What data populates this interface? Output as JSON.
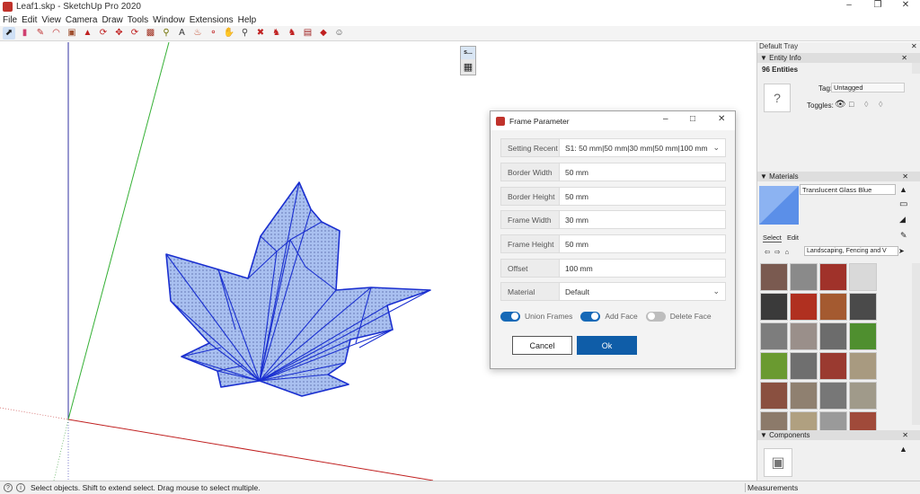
{
  "window": {
    "title": "Leaf1.skp - SketchUp Pro 2020",
    "minimize": "–",
    "maximize": "❐",
    "close": "✕"
  },
  "menu": [
    "File",
    "Edit",
    "View",
    "Camera",
    "Draw",
    "Tools",
    "Window",
    "Extensions",
    "Help"
  ],
  "toolbar_icons": [
    "select-arrow-icon",
    "eraser-icon",
    "pencil-line-icon",
    "arc-icon",
    "rectangle-icon",
    "push-pull-icon",
    "follow-me-icon",
    "move-icon",
    "rotate-icon",
    "scale-icon",
    "tape-measure-icon",
    "text-icon",
    "paint-bucket-icon",
    "orbit-icon",
    "pan-icon",
    "zoom-icon",
    "zoom-extents-icon",
    "warehouse-icon",
    "extension-warehouse-icon",
    "layout-icon",
    "ruby-icon",
    "profile-icon"
  ],
  "mini_toolbar": {
    "label": "s...",
    "icon": "frame-grid-icon"
  },
  "dialog": {
    "title": "Frame Parameter",
    "fields": [
      {
        "label": "Setting Recent",
        "value": "S1: 50 mm|50 mm|30 mm|50 mm|100 mm",
        "dropdown": true
      },
      {
        "label": "Border Width",
        "value": "50 mm",
        "dropdown": false
      },
      {
        "label": "Border Height",
        "value": "50 mm",
        "dropdown": false
      },
      {
        "label": "Frame Width",
        "value": "30 mm",
        "dropdown": false
      },
      {
        "label": "Frame Height",
        "value": "50 mm",
        "dropdown": false
      },
      {
        "label": "Offset",
        "value": "100 mm",
        "dropdown": false
      },
      {
        "label": "Material",
        "value": "Default",
        "dropdown": true
      }
    ],
    "toggles": [
      {
        "label": "Union Frames",
        "on": true
      },
      {
        "label": "Add Face",
        "on": true
      },
      {
        "label": "Delete Face",
        "on": false
      }
    ],
    "cancel": "Cancel",
    "ok": "Ok"
  },
  "tray": {
    "title": "Default Tray",
    "entity_info": {
      "header": "Entity Info",
      "count": "96 Entities",
      "tag_label": "Tag:",
      "tag_value": "Untagged",
      "toggles_label": "Toggles:"
    },
    "materials": {
      "header": "Materials",
      "name": "Translucent Glass Blue",
      "tab_select": "Select",
      "tab_edit": "Edit",
      "library": "Landscaping, Fencing and V",
      "swatches": [
        "#7a5a50",
        "#8a8a8a",
        "#a0322a",
        "#d9d9d9",
        "#3a3a3a",
        "#b03020",
        "#a45a30",
        "#4a4a4a",
        "#7d7d7d",
        "#9a8f8a",
        "#6c6c6c",
        "#4f8f2f",
        "#6a9a30",
        "#6f6f6f",
        "#9a3a30",
        "#a89a80",
        "#8a5040",
        "#8f8070",
        "#777777",
        "#a09a8a",
        "#8c7a6a",
        "#b0a080",
        "#9a9a9a",
        "#a04a3a"
      ]
    },
    "components": {
      "header": "Components"
    }
  },
  "status": {
    "message": "Select objects. Shift to extend select. Drag mouse to select multiple.",
    "measurements": "Measurements"
  },
  "colors": {
    "leaf_fill": "#a9c0f0",
    "leaf_stroke": "#1a2fd0",
    "axis_green": "#35b035",
    "axis_red": "#c02020",
    "axis_blue": "#3030a0",
    "ok_button": "#0f5da8",
    "toggle_on": "#1669b7"
  }
}
